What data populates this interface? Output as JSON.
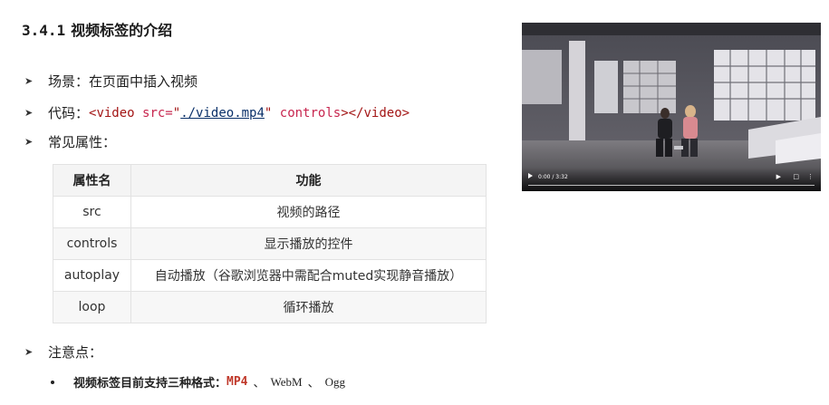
{
  "title": {
    "number": "3.4.1",
    "text": "视频标签的介绍"
  },
  "bullets": {
    "scene": {
      "label": "场景：",
      "text": "在页面中插入视频"
    },
    "code": {
      "label": "代码：",
      "open_tag": "<video",
      "attr_src": " src=",
      "quote_open": "\"",
      "src_value": "./video.mp4",
      "quote_close": "\"",
      "attr_controls": " controls",
      "close": "></video>"
    },
    "attrs": {
      "label": "常见属性："
    },
    "notes": {
      "label": "注意点："
    }
  },
  "table": {
    "headers": [
      "属性名",
      "功能"
    ],
    "rows": [
      {
        "name": "src",
        "desc": "视频的路径"
      },
      {
        "name": "controls",
        "desc": "显示播放的控件"
      },
      {
        "name": "autoplay",
        "desc": "自动播放（谷歌浏览器中需配合muted实现静音播放）"
      },
      {
        "name": "loop",
        "desc": "循环播放"
      }
    ]
  },
  "note": {
    "text": "视频标签目前支持三种格式：",
    "formats": [
      "MP4",
      "WebM",
      "Ogg"
    ],
    "separator": "、"
  },
  "video": {
    "time": "0:00 / 3:32",
    "play_icon": "play-icon",
    "volume_icon": "volume-icon",
    "fullscreen_icon": "fullscreen-icon",
    "more_icon": "more-icon"
  }
}
